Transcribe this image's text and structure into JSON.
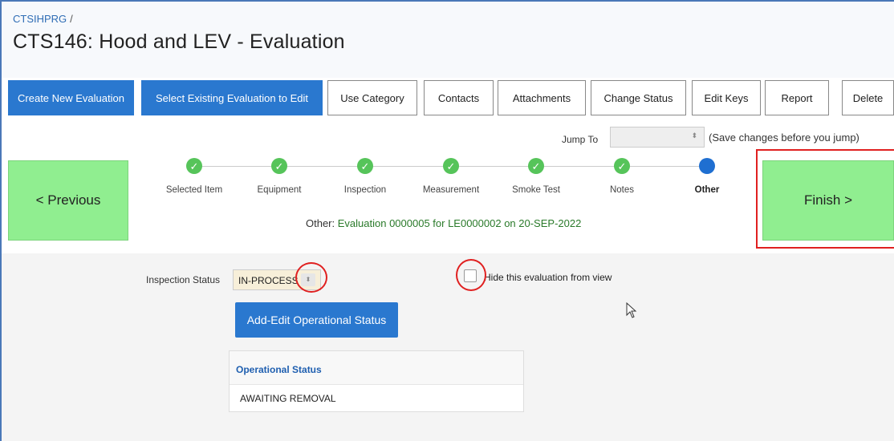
{
  "breadcrumb": {
    "app": "CTSIHPRG",
    "separator": "/"
  },
  "page": {
    "title": "CTS146: Hood and LEV - Evaluation"
  },
  "toolbar": {
    "buttons": [
      {
        "label": "Create New Evaluation",
        "style": "primary"
      },
      {
        "label": "Select Existing Evaluation to Edit",
        "style": "primary"
      },
      {
        "label": "Use Category",
        "style": "default"
      },
      {
        "label": "Contacts",
        "style": "default"
      },
      {
        "label": "Attachments",
        "style": "default"
      },
      {
        "label": "Change Status",
        "style": "default"
      },
      {
        "label": "Edit Keys",
        "style": "default"
      },
      {
        "label": "Report",
        "style": "default"
      },
      {
        "label": "Delete",
        "style": "default"
      }
    ]
  },
  "jump": {
    "label": "Jump To",
    "selected": "",
    "note": "(Save changes before you jump)"
  },
  "nav": {
    "previous_label": "< Previous",
    "finish_label": "Finish >"
  },
  "wizard": {
    "steps": [
      {
        "label": "Selected Item",
        "state": "done"
      },
      {
        "label": "Equipment",
        "state": "done"
      },
      {
        "label": "Inspection",
        "state": "done"
      },
      {
        "label": "Measurement",
        "state": "done"
      },
      {
        "label": "Smoke Test",
        "state": "done"
      },
      {
        "label": "Notes",
        "state": "done"
      },
      {
        "label": "Other",
        "state": "current"
      }
    ],
    "check_glyph": "✓"
  },
  "evaluation": {
    "prefix": "Other:",
    "text": "Evaluation 0000005 for LE0000002 on 20-SEP-2022"
  },
  "form": {
    "inspection_status_label": "Inspection Status",
    "inspection_status_value": "IN-PROCESS",
    "hide_label": "Hide this evaluation from view",
    "hide_checked": false,
    "add_edit_label": "Add-Edit Operational Status"
  },
  "op_table": {
    "header": "Operational Status",
    "rows": [
      "AWAITING REMOVAL"
    ]
  },
  "colors": {
    "primary": "#2a78cf",
    "done_step": "#56c45a",
    "current_step": "#1f6fd1",
    "nav_button": "#90ee90",
    "annotation_red": "#e02020"
  }
}
